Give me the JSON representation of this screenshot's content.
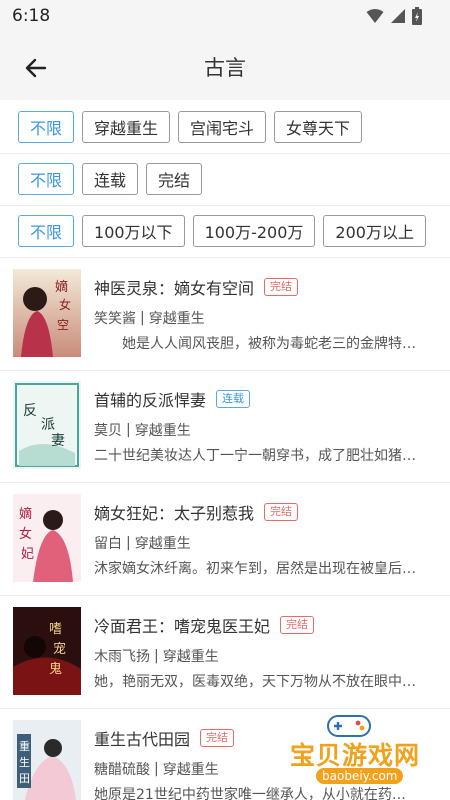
{
  "status_bar": {
    "time": "6:18"
  },
  "header": {
    "title": "古言"
  },
  "filters": {
    "row1": [
      "不限",
      "穿越重生",
      "宫闱宅斗",
      "女尊天下"
    ],
    "row2": [
      "不限",
      "连载",
      "完结"
    ],
    "row3": [
      "不限",
      "100万以下",
      "100万-200万",
      "200万以上"
    ],
    "active_index": 0
  },
  "books": [
    {
      "title": "神医灵泉：嫡女有空间",
      "status": "完结",
      "author": "笑笑酱",
      "category": "穿越重生",
      "desc": "她是人人闻风丧胆，被称为毒蛇老三的金牌特…",
      "cover_text": "嫡女有空间"
    },
    {
      "title": "首辅的反派悍妻",
      "status": "连载",
      "author": "莫贝",
      "category": "穿越重生",
      "desc": "二十世纪美妆达人丁一宁一朝穿书，成了肥壮如猪…",
      "cover_text": "反派悍妻"
    },
    {
      "title": "嫡女狂妃：太子别惹我",
      "status": "完结",
      "author": "留白",
      "category": "穿越重生",
      "desc": "沐家嫡女沐纤离。初来乍到，居然是出现在被皇后…",
      "cover_text": "嫡女狂妃"
    },
    {
      "title": "冷面君王：嗜宠鬼医王妃",
      "status": "完结",
      "author": "木雨飞扬",
      "category": "穿越重生",
      "desc": "她，艳丽无双，医毒双绝，天下万物从不放在眼中…",
      "cover_text": "嗜宠鬼医"
    },
    {
      "title": "重生古代田园",
      "status": "完结",
      "author": "糖醋硫酸",
      "category": "穿越重生",
      "desc": "她原是21世纪中药世家唯一继承人，从小就在药…",
      "cover_text": "重生古代田园"
    }
  ],
  "watermark": {
    "text": "宝贝游戏网",
    "url": "baobeiy.com"
  },
  "colors": {
    "accent": "#3a97e0",
    "done": "#e66a6a",
    "header_bg": "#f5f5f5"
  }
}
